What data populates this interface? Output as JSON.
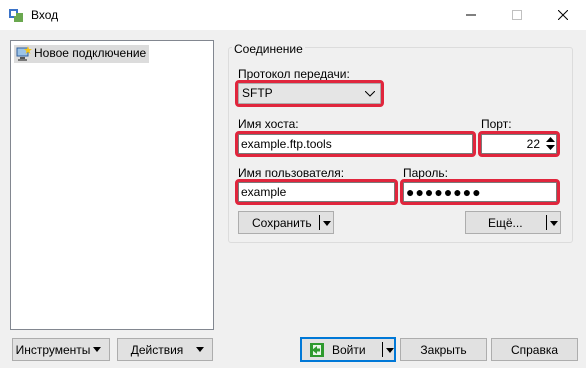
{
  "window": {
    "title": "Вход",
    "controls": {
      "minimize": "minimize",
      "maximize": "maximize",
      "close": "close"
    }
  },
  "sidebar": {
    "items": [
      {
        "label": "Новое подключение",
        "icon": "new-site-icon",
        "selected": true
      }
    ]
  },
  "session": {
    "group_label": "Соединение",
    "protocol": {
      "label": "Протокол передачи:",
      "value": "SFTP"
    },
    "host": {
      "label": "Имя хоста:",
      "value": "example.ftp.tools"
    },
    "port": {
      "label": "Порт:",
      "value": "22"
    },
    "user": {
      "label": "Имя пользователя:",
      "value": "example"
    },
    "password": {
      "label": "Пароль:",
      "value": "●●●●●●●●"
    },
    "save_button": "Сохранить",
    "more_button": "Ещё..."
  },
  "footer": {
    "tools_button": "Инструменты",
    "actions_button": "Действия",
    "login_button": "Войти",
    "close_button": "Закрыть",
    "help_button": "Справка"
  },
  "colors": {
    "highlight": "#e0263d",
    "accent": "#0078d7",
    "login_icon": "#2e9a2e"
  }
}
